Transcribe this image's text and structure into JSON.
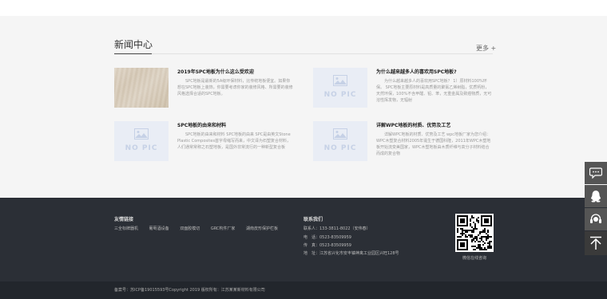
{
  "news": {
    "title": "新闻中心",
    "more": "更多 +",
    "articles": [
      {
        "title": "2019年SPC地板为什么这么受欢迎",
        "excerpt": "SPC地板是最新的5A级环保材料，比传统地板便宜。如果你想在SPC地板上装饰，你需要考虑你家的装修风格、所需要的装修风格选择合适的SPC地板。",
        "image": "wood-texture"
      },
      {
        "title": "为什么越来越多人的喜欢用SPC地板?",
        "excerpt": "为什么越来越多人的喜欢用SPC地板？ 1）原材料100%环保。 SPC地板主要原材料是高质量的聚氯乙烯树脂，优质钙粉，天然环保，100%不含甲醛、铅、苯，无重金属及致癌物质，无可溶性挥发物，无辐射",
        "image": "no-pic"
      },
      {
        "title": "SPC地板的由来和材料",
        "excerpt": "SPC地板的由来和材料 SPC地板的由来 SPC是由英文Stone Plastic Composites首字母缩写而来，中文译为石塑复合材料，人们通常常称之石塑地板，是国外非常流行的一种新型复合板",
        "image": "no-pic"
      },
      {
        "title": "详解WPC地板的材质、优势及工艺",
        "excerpt": "详解WPC地板的材质、优势及工艺 wpc地板厂家为您介绍： WPC木塑复合材料2005年诞生于德国科隆，2011年WPC木塑地板开始流变美国家，WPC木塑地板由木质纤维与高分子材料结合而成的复合物",
        "image": "no-pic"
      }
    ],
    "nopic_label": "NO PIC"
  },
  "footer": {
    "links_heading": "友情链接",
    "links": [
      "三全标牌器机",
      "葡萄酒设备",
      "双面胶模切",
      "GRC构件厂家",
      "湖南皮形保护栏板"
    ],
    "contact_heading": "联系我们",
    "contact": [
      "联系人：133-3811-8022（安伟春）",
      "电　话：0523-83509959",
      "传　真：0523-83509959",
      "地　址：江苏省兴化市安丰镇神禽工业园区兴旺128号"
    ],
    "qr_label": "微信在线咨询",
    "copyright": "备案号：苏ICP备19015593号Copyright 2019 版权所有：江苏某某新材料有限公司"
  },
  "float_bar": {
    "icons": [
      "chat-icon",
      "qq-icon",
      "service-icon",
      "back-to-top-icon"
    ]
  },
  "colors": {
    "footer_bg": "#2b2f36",
    "bottom_bar_bg": "#22262c",
    "section_bg": "#f5f5f5",
    "float_bg": "#555555"
  }
}
